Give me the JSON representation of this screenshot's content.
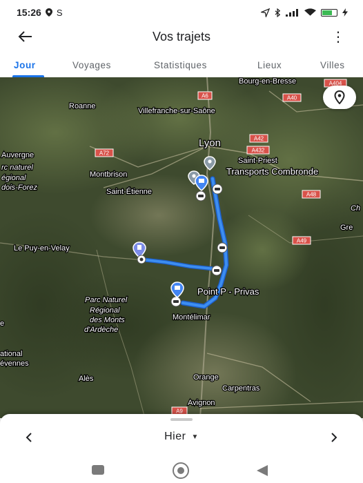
{
  "status_bar": {
    "time": "15:26",
    "extra": "S"
  },
  "app_bar": {
    "title": "Vos trajets",
    "menu_glyph": "⋮"
  },
  "tabs": [
    {
      "label": "Jour",
      "active": true
    },
    {
      "label": "Voyages",
      "active": false
    },
    {
      "label": "Statistiques",
      "active": false
    },
    {
      "label": "Lieux",
      "active": false
    },
    {
      "label": "Villes",
      "active": false
    }
  ],
  "map": {
    "places": {
      "bourg": "Bourg-en-Bresse",
      "roanne": "Roanne",
      "villefranche": "Villefranche-sur-Saône",
      "lyon": "Lyon",
      "saint_priest": "Saint-Priest",
      "transports": "Transports Combronde",
      "montbrison": "Montbrison",
      "saint_etienne": "Saint-Étienne",
      "auvergne": "Auvergne",
      "parc_forez_1": "rc naturel",
      "parc_forez_2": "égional",
      "parc_forez_3": "dois-Forez",
      "le_puy": "Le Puy-en-Velay",
      "point_p": "Point P - Privas",
      "montelimar": "Montélimar",
      "parc_ard_1": "Parc Naturel",
      "parc_ard_2": "Régional",
      "parc_ard_3": "des Monts",
      "parc_ard_4": "d'Ardèche",
      "national": "ational",
      "cevennes": "évennes",
      "ales": "Alès",
      "orange": "Orange",
      "carpentras": "Carpentras",
      "avignon": "Avignon",
      "gre": "Gre",
      "ch": "Ch",
      "e_left": "e"
    },
    "roads": {
      "a6": "A6",
      "a40": "A40",
      "a404": "A404",
      "a42": "A42",
      "a432": "A432",
      "a72": "A72",
      "a48": "A48",
      "a49": "A49",
      "a9": "A9"
    },
    "icons": [
      "location-pin-icon",
      "car-icon",
      "shopping-icon",
      "gas-station-icon"
    ]
  },
  "bottom": {
    "day_label": "Hier"
  },
  "colors": {
    "accent": "#1a73e8",
    "route": "#3d8ef0",
    "road_shield": "#d8524a"
  }
}
